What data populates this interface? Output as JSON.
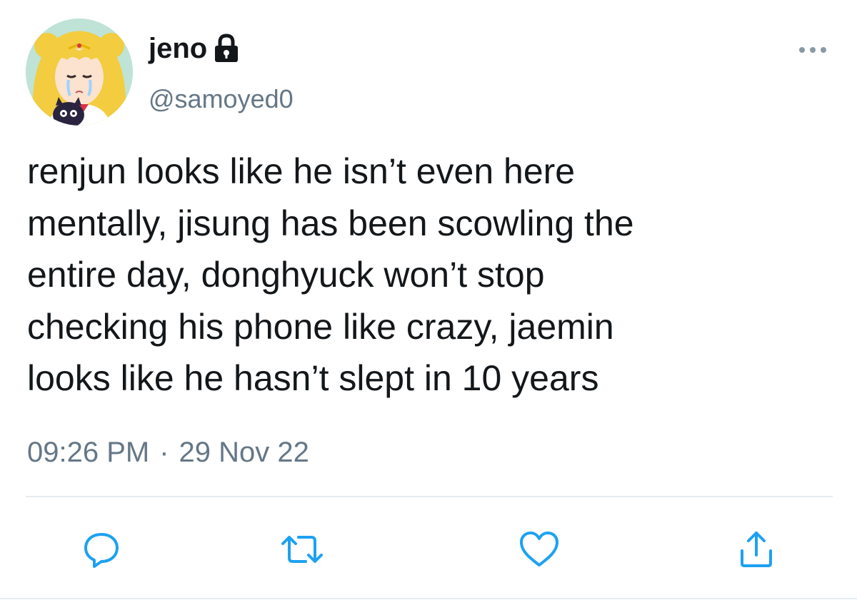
{
  "user": {
    "display_name": "jeno",
    "handle": "@samoyed0",
    "avatar_icon": "anime-avatar",
    "protected_icon": "lock-icon"
  },
  "tweet": {
    "text": "renjun looks like he isn’t even here\nmentally, jisung has been scowling the\nentire day, donghyuck won’t stop\nchecking his phone like crazy, jaemin\nlooks like he hasn’t slept in 10 years",
    "time": "09:26 PM",
    "separator": "·",
    "date": "29 Nov 22"
  },
  "actions": {
    "reply_icon": "reply-icon",
    "retweet_icon": "retweet-icon",
    "like_icon": "heart-icon",
    "share_icon": "share-icon",
    "more_icon": "more-icon"
  },
  "colors": {
    "text": "#14171a",
    "secondary": "#657786",
    "icon": "#1da1f2",
    "divider": "#e6ecf0"
  }
}
